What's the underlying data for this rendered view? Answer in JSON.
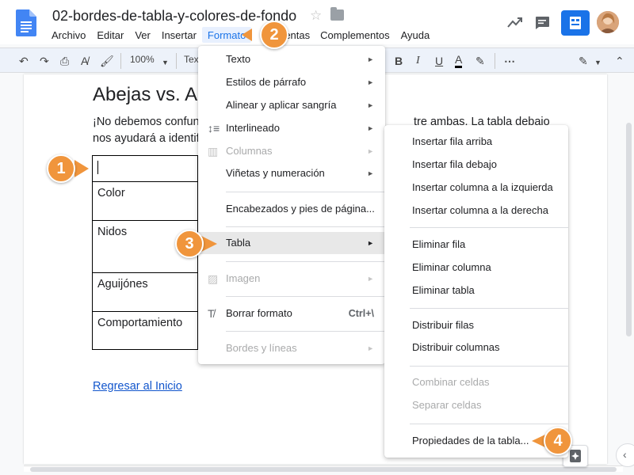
{
  "document": {
    "title": "02-bordes-de-tabla-y-colores-de-fondo"
  },
  "menubar": [
    "Archivo",
    "Editar",
    "Ver",
    "Insertar",
    "Formato",
    "Herramientas_hidden",
    "Complementos",
    "Ayuda"
  ],
  "menubar_visible": {
    "archivo": "Archivo",
    "editar": "Editar",
    "ver": "Ver",
    "insertar": "Insertar",
    "formato": "Formato",
    "herramientas_tail": "entas",
    "complementos": "Complementos",
    "ayuda": "Ayuda"
  },
  "toolbar": {
    "zoom": "100%",
    "style_partial": "Tex"
  },
  "doc": {
    "heading_partial": "Abejas vs. A",
    "line1_start": "¡No debemos confun",
    "line1_end": "tre ambas. La tabla debajo",
    "line2": "nos ayudará a identif",
    "table_rows": [
      "",
      "Color",
      "Nidos",
      "Aguijónes",
      "Comportamiento"
    ],
    "back_link": "Regresar al Inicio"
  },
  "format_menu": {
    "items": [
      {
        "label": "Texto",
        "submenu": true,
        "disabled": false
      },
      {
        "label": "Estilos de párrafo",
        "submenu": true,
        "disabled": false
      },
      {
        "label": "Alinear y aplicar sangría",
        "submenu": true,
        "disabled": false
      },
      {
        "label": "Interlineado",
        "submenu": true,
        "disabled": false,
        "icon": "line-spacing-icon"
      },
      {
        "label": "Columnas",
        "submenu": true,
        "disabled": true,
        "icon": "columns-icon"
      },
      {
        "label": "Viñetas y numeración",
        "submenu": true,
        "disabled": false
      },
      {
        "label": "Encabezados y pies de página...",
        "submenu": false,
        "disabled": false
      },
      {
        "label": "Tabla",
        "submenu": true,
        "disabled": false,
        "highlighted": true
      },
      {
        "label": "Imagen",
        "submenu": true,
        "disabled": true,
        "icon": "image-icon"
      },
      {
        "label": "Borrar formato",
        "shortcut": "Ctrl+\\",
        "disabled": false,
        "icon": "clear-format-icon"
      },
      {
        "label": "Bordes y líneas",
        "submenu": true,
        "disabled": true
      }
    ]
  },
  "table_menu": {
    "items": [
      {
        "label": "Insertar fila arriba",
        "disabled": false
      },
      {
        "label": "Insertar fila debajo",
        "disabled": false
      },
      {
        "label": "Insertar columna a la izquierda",
        "disabled": false
      },
      {
        "label": "Insertar columna a la derecha",
        "disabled": false
      },
      {
        "label": "Eliminar fila",
        "disabled": false
      },
      {
        "label": "Eliminar columna",
        "disabled": false
      },
      {
        "label": "Eliminar tabla",
        "disabled": false
      },
      {
        "label": "Distribuir filas",
        "disabled": false
      },
      {
        "label": "Distribuir columnas",
        "disabled": false
      },
      {
        "label": "Combinar celdas",
        "disabled": true
      },
      {
        "label": "Separar celdas",
        "disabled": true
      },
      {
        "label": "Propiedades de la tabla...",
        "disabled": false
      }
    ]
  },
  "callouts": [
    "1",
    "2",
    "3",
    "4"
  ],
  "colors": {
    "accent": "#1a73e8",
    "callout": "#f0953c",
    "link": "#1155cc",
    "menu_highlight": "#e8e8e8"
  }
}
